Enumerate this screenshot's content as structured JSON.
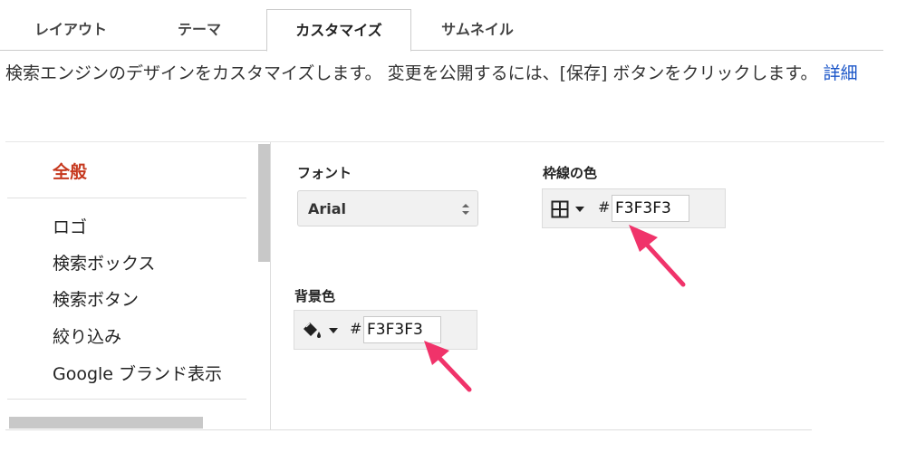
{
  "tabs": [
    {
      "label": "レイアウト"
    },
    {
      "label": "テーマ"
    },
    {
      "label": "カスタマイズ"
    },
    {
      "label": "サムネイル"
    }
  ],
  "description": {
    "text": "検索エンジンのデザインをカスタマイズします。 変更を公開するには、[保存] ボタンをクリックします。",
    "link": "詳細"
  },
  "nav": {
    "items": [
      {
        "label": "全般"
      },
      {
        "label": "ロゴ"
      },
      {
        "label": "検索ボックス"
      },
      {
        "label": "検索ボタン"
      },
      {
        "label": "絞り込み"
      },
      {
        "label": "Google ブランド表示"
      }
    ]
  },
  "form": {
    "font_label": "フォント",
    "font_value": "Arial",
    "border_color_label": "枠線の色",
    "border_color_value": "F3F3F3",
    "bg_color_label": "背景色",
    "bg_color_value": "F3F3F3",
    "hash": "#"
  },
  "colors": {
    "accent_active": "#c6381e",
    "link": "#1a55c8",
    "annotation_arrow": "#f0336a"
  }
}
